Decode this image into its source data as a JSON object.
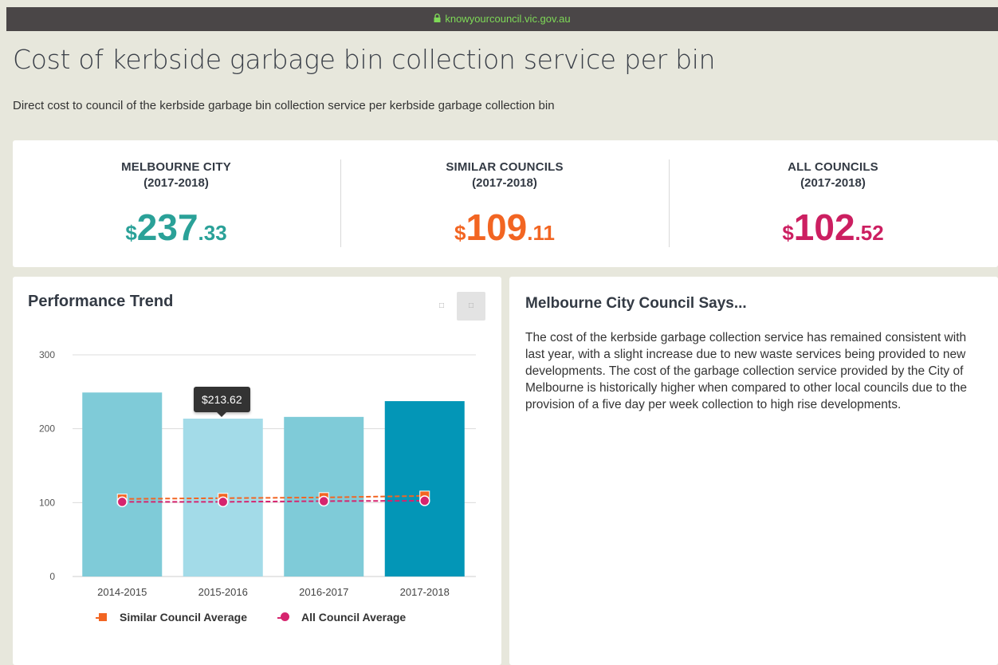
{
  "browser": {
    "url": "knowyourcouncil.vic.gov.au"
  },
  "page": {
    "title": "Cost of kerbside garbage bin collection service per bin",
    "subtitle": "Direct cost to council of the kerbside garbage bin collection service per kerbside garbage collection bin"
  },
  "stats": [
    {
      "name": "MELBOURNE CITY",
      "year": "(2017-2018)",
      "currency": "$",
      "whole": "237",
      "cents": ".33",
      "color": "#2aa198"
    },
    {
      "name": "SIMILAR COUNCILS",
      "year": "(2017-2018)",
      "currency": "$",
      "whole": "109",
      "cents": ".11",
      "color": "#f26522"
    },
    {
      "name": "ALL COUNCILS",
      "year": "(2017-2018)",
      "currency": "$",
      "whole": "102",
      "cents": ".52",
      "color": "#cc1f61"
    }
  ],
  "trend": {
    "title": "Performance Trend",
    "tooltip": "$213.62"
  },
  "says": {
    "title": "Melbourne City Council Says...",
    "text": "The cost of the kerbside garbage collection service has remained consistent with last year, with a slight increase due to new waste services being provided to new developments. The cost of the garbage collection service provided by the City of Melbourne is historically higher when compared to other local councils due to the provision of a five day per week collection to high rise developments."
  },
  "chart_data": {
    "type": "bar",
    "categories": [
      "2014-2015",
      "2015-2016",
      "2016-2017",
      "2017-2018"
    ],
    "series": [
      {
        "values": [
          249,
          213.62,
          216,
          237.33
        ],
        "colors": [
          "#7fcbd8",
          "#a3dbe8",
          "#7fcbd8",
          "#0396b7"
        ]
      },
      {
        "name": "Similar Council Average",
        "type": "line",
        "values": [
          105,
          106,
          107,
          109.11
        ],
        "color": "#f26522"
      },
      {
        "name": "All Council Average",
        "type": "line",
        "values": [
          101,
          101,
          102,
          102.52
        ],
        "color": "#d6246e"
      }
    ],
    "yticks": [
      0,
      100,
      200,
      300
    ],
    "ylim": [
      0,
      300
    ],
    "grid": true,
    "legend": "bottom"
  },
  "icons": {
    "chart_view": "bar-chart-icon",
    "table_view": "table-icon"
  }
}
